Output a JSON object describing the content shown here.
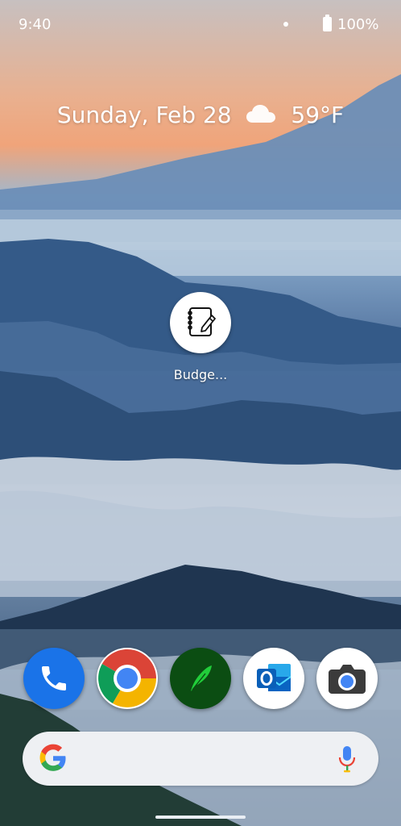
{
  "status_bar": {
    "time": "9:40",
    "battery_percent": "100%"
  },
  "at_a_glance": {
    "date": "Sunday, Feb 28",
    "temperature": "59°F",
    "weather_icon": "cloud-icon"
  },
  "home_apps": [
    {
      "label": "Budge...",
      "icon": "budget-notebook-pencil-icon"
    }
  ],
  "dock": [
    {
      "icon": "phone-icon",
      "color": "#1a73e8"
    },
    {
      "icon": "chrome-icon",
      "color": "#4285f4"
    },
    {
      "icon": "robinhood-feather-icon",
      "color": "#0b4d12"
    },
    {
      "icon": "outlook-icon",
      "color": "#0a64c2"
    },
    {
      "icon": "camera-icon",
      "color": "#3b3b3b"
    }
  ],
  "search_bar": {
    "left_icon": "google-g-icon",
    "right_icon": "microphone-icon"
  }
}
